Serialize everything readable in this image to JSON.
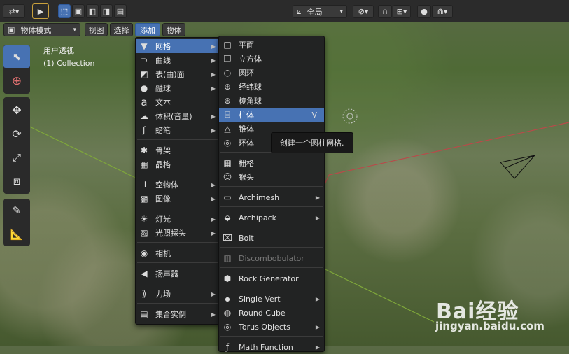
{
  "header": {
    "mode_select": "物体模式",
    "menus": [
      "视图",
      "选择",
      "添加",
      "物体"
    ],
    "transform_orientation": "全局"
  },
  "viewport": {
    "view_name": "用户透视",
    "collection": "(1) Collection"
  },
  "add_menu": {
    "items": [
      {
        "label": "网格",
        "icon": "mesh-icon",
        "submenu": true
      },
      {
        "label": "曲线",
        "icon": "curve-icon",
        "submenu": true
      },
      {
        "label": "表(曲)面",
        "icon": "surface-icon",
        "submenu": true
      },
      {
        "label": "融球",
        "icon": "metaball-icon",
        "submenu": true
      },
      {
        "label": "文本",
        "icon": "text-icon",
        "submenu": false
      },
      {
        "label": "体积(音量)",
        "icon": "volume-icon",
        "submenu": true
      },
      {
        "label": "蜡笔",
        "icon": "grease-pencil-icon",
        "submenu": true
      },
      {
        "label": "骨架",
        "icon": "armature-icon",
        "submenu": false
      },
      {
        "label": "晶格",
        "icon": "lattice-icon",
        "submenu": false
      },
      {
        "label": "空物体",
        "icon": "empty-icon",
        "submenu": true
      },
      {
        "label": "图像",
        "icon": "image-icon",
        "submenu": true
      },
      {
        "label": "灯光",
        "icon": "light-icon",
        "submenu": true
      },
      {
        "label": "光照探头",
        "icon": "light-probe-icon",
        "submenu": true
      },
      {
        "label": "相机",
        "icon": "camera-icon",
        "submenu": false
      },
      {
        "label": "扬声器",
        "icon": "speaker-icon",
        "submenu": false
      },
      {
        "label": "力场",
        "icon": "force-field-icon",
        "submenu": true
      },
      {
        "label": "集合实例",
        "icon": "collection-instance-icon",
        "submenu": true
      }
    ]
  },
  "mesh_menu": {
    "items": [
      {
        "label": "平面",
        "icon": "plane-icon"
      },
      {
        "label": "立方体",
        "icon": "cube-icon"
      },
      {
        "label": "圆环",
        "icon": "circle-icon"
      },
      {
        "label": "经纬球",
        "icon": "uv-sphere-icon"
      },
      {
        "label": "棱角球",
        "icon": "ico-sphere-icon"
      },
      {
        "label": "柱体",
        "icon": "cylinder-icon",
        "shortcut": "V"
      },
      {
        "label": "锥体",
        "icon": "cone-icon"
      },
      {
        "label": "环体",
        "icon": "torus-icon"
      },
      {
        "label": "栅格",
        "icon": "grid-icon"
      },
      {
        "label": "猴头",
        "icon": "monkey-icon"
      },
      {
        "label": "Archimesh",
        "icon": "archimesh-icon",
        "submenu": true
      },
      {
        "label": "Archipack",
        "icon": "archipack-icon",
        "submenu": true
      },
      {
        "label": "Bolt",
        "icon": "bolt-icon"
      },
      {
        "label": "Discombobulator",
        "icon": "discombobulator-icon"
      },
      {
        "label": "Rock Generator",
        "icon": "rock-icon"
      },
      {
        "label": "Single Vert",
        "icon": "vert-icon",
        "submenu": true
      },
      {
        "label": "Round Cube",
        "icon": "round-cube-icon"
      },
      {
        "label": "Torus Objects",
        "icon": "torus-objects-icon",
        "submenu": true
      },
      {
        "label": "Math Function",
        "icon": "math-icon",
        "submenu": true
      }
    ]
  },
  "tooltip": "创建一个圆柱网格.",
  "watermark": {
    "brand": "Bai经验",
    "url": "jingyan.baidu.com"
  },
  "colors": {
    "accent": "#4772b3",
    "menu_bg": "#222323"
  }
}
